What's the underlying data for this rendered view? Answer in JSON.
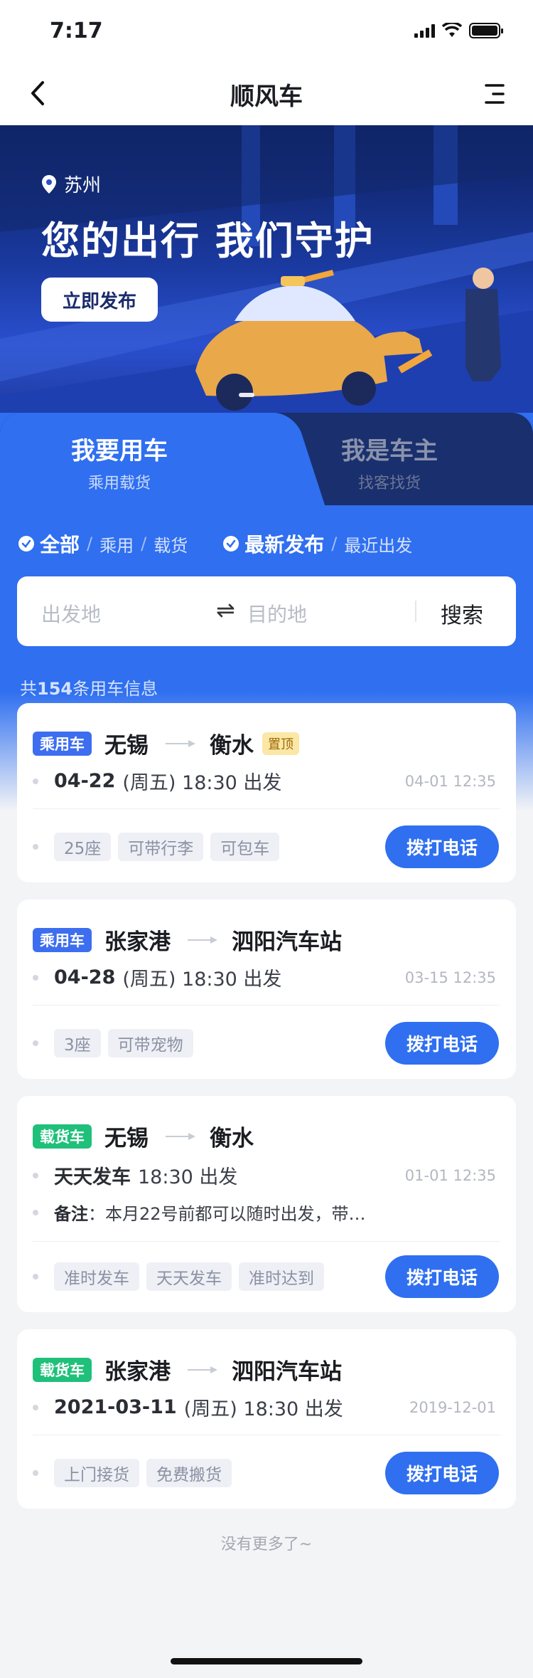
{
  "status_bar": {
    "time": "7:17"
  },
  "nav": {
    "title": "顺风车"
  },
  "banner": {
    "location": "苏州",
    "slogan": "您的出行 我们守护",
    "publish_button": "立即发布"
  },
  "tabs": [
    {
      "title": "我要用车",
      "subtitle": "乘用载货",
      "active": true
    },
    {
      "title": "我是车主",
      "subtitle": "找客找货",
      "active": false
    }
  ],
  "filters": {
    "type_selected": "全部",
    "type_options": [
      "乘用",
      "载货"
    ],
    "sort_selected": "最新发布",
    "sort_options": [
      "最近出发"
    ]
  },
  "search": {
    "from_placeholder": "出发地",
    "swap_symbol": "⇌",
    "to_placeholder": "目的地",
    "button": "搜索"
  },
  "result_count_prefix": "共",
  "result_count": "154",
  "result_count_suffix": "条用车信息",
  "cards": [
    {
      "badge": "乘用车",
      "from": "无锡",
      "to": "衡水",
      "top_tag": "置顶",
      "date": "04-22",
      "weekday": "(周五)",
      "time": "18:30 出发",
      "posted": "04-01 12:35",
      "tags": [
        "25座",
        "可带行李",
        "可包车"
      ],
      "call": "拨打电话"
    },
    {
      "badge": "乘用车",
      "from": "张家港",
      "to": "泗阳汽车站",
      "date": "04-28",
      "weekday": "(周五)",
      "time": "18:30 出发",
      "posted": "03-15 12:35",
      "tags": [
        "3座",
        "可带宠物"
      ],
      "call": "拨打电话"
    },
    {
      "badge": "载货车",
      "from": "无锡",
      "to": "衡水",
      "date": "天天发车",
      "time": "18:30 出发",
      "posted": "01-01 12:35",
      "note_label": "备注",
      "note": "：本月22号前都可以随时出发，带…",
      "tags": [
        "准时发车",
        "天天发车",
        "准时达到"
      ],
      "call": "拨打电话"
    },
    {
      "badge": "载货车",
      "from": "张家港",
      "to": "泗阳汽车站",
      "date": "2021-03-11",
      "weekday": "(周五)",
      "time": "18:30 出发",
      "posted": "2019-12-01",
      "tags": [
        "上门接货",
        "免费搬货"
      ],
      "call": "拨打电话"
    }
  ],
  "footer": {
    "no_more": "没有更多了~"
  },
  "colors": {
    "primary": "#2f6ff0",
    "badge_passenger": "#3d6ef0",
    "badge_cargo": "#1fc07a",
    "top_tag": "#fbe7a6"
  }
}
